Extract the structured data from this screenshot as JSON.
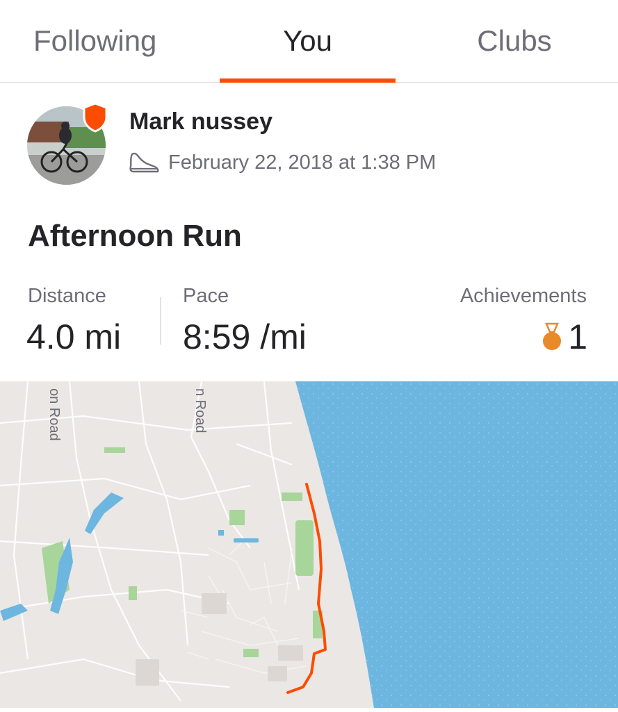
{
  "tabs": {
    "following": "Following",
    "you": "You",
    "clubs": "Clubs"
  },
  "activity": {
    "athlete_name": "Mark nussey",
    "sport_icon": "shoe-icon",
    "date": "February 22, 2018 at 1:38 PM",
    "title": "Afternoon Run",
    "stats": {
      "distance_label": "Distance",
      "distance_value": "4.0 mi",
      "pace_label": "Pace",
      "pace_value": "8:59 /mi",
      "achievements_label": "Achievements",
      "achievements_value": "1"
    }
  },
  "map": {
    "road_labels": [
      "on Road",
      "n Road"
    ]
  },
  "colors": {
    "accent": "#fc4c02",
    "medal": "#e8892a",
    "water": "#6db6e0",
    "land": "#ebe7e4",
    "park": "#a8d59a"
  }
}
